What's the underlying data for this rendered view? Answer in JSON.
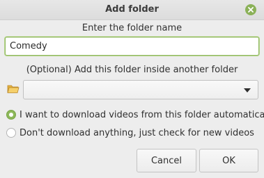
{
  "window": {
    "title": "Add folder",
    "close_icon": "close-icon"
  },
  "form": {
    "name_label": "Enter the folder name",
    "name_value": "Comedy",
    "parent_label": "(Optional) Add this folder inside another folder",
    "parent_selected": "",
    "folder_icon": "folder-open-icon"
  },
  "options": [
    {
      "label": "I want to download videos from this folder automatically",
      "selected": true
    },
    {
      "label": "Don't download anything, just check for new videos",
      "selected": false
    }
  ],
  "buttons": {
    "cancel": "Cancel",
    "ok": "OK"
  },
  "colors": {
    "accent": "#8db85a",
    "background": "#ededed"
  }
}
